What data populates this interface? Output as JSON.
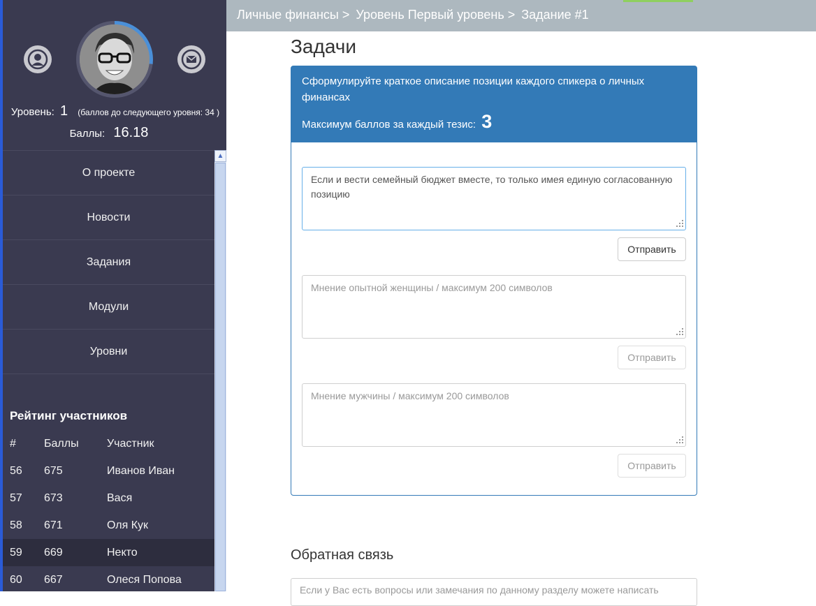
{
  "breadcrumb": {
    "items": [
      "Личные финансы >",
      "Уровень Первый уровень >",
      "Задание #1"
    ]
  },
  "profile": {
    "level_label": "Уровень:",
    "level_value": "1",
    "level_hint": "(баллов до следующего уровня: 34 )",
    "score_label": "Баллы:",
    "score_value": "16.18",
    "level_progress_percent": 27
  },
  "menu": {
    "items": [
      "О проекте",
      "Новости",
      "Задания",
      "Модули",
      "Уровни"
    ]
  },
  "rating": {
    "title": "Рейтинг участников",
    "headers": [
      "#",
      "Баллы",
      "Участник"
    ],
    "rows": [
      {
        "rank": "56",
        "points": "675",
        "name": "Иванов Иван"
      },
      {
        "rank": "57",
        "points": "673",
        "name": "Вася"
      },
      {
        "rank": "58",
        "points": "671",
        "name": "Оля Кук"
      },
      {
        "rank": "59",
        "points": "669",
        "name": "Некто"
      },
      {
        "rank": "60",
        "points": "667",
        "name": "Олеся Попова"
      }
    ]
  },
  "main": {
    "title": "Задачи",
    "panel": {
      "description": "Сформулируйте краткое описание позиции каждого спикера о личных финансах",
      "max_label": "Максимум баллов за каждый тезис:",
      "max_value": "3"
    },
    "answers": [
      {
        "value": "Если и вести семейный бюджет вместе, то только имея единую согласованную позицию",
        "placeholder": "",
        "button": "Отправить"
      },
      {
        "value": "",
        "placeholder": "Мнение опытной женщины / максимум 200 символов",
        "button": "Отправить"
      },
      {
        "value": "",
        "placeholder": "Мнение мужчины / максимум 200 символов",
        "button": "Отправить"
      }
    ],
    "feedback": {
      "title": "Обратная связь",
      "placeholder": "Если у Вас есть вопросы или замечания по данному разделу можете написать"
    }
  },
  "colors": {
    "sidebar": "#3a3a50",
    "panel_primary": "#337ab7",
    "topbar": "#adb8bf",
    "progress_ring": "#4a8fd8"
  },
  "icons": {
    "profile": "user-icon",
    "messages": "mail-icon"
  }
}
